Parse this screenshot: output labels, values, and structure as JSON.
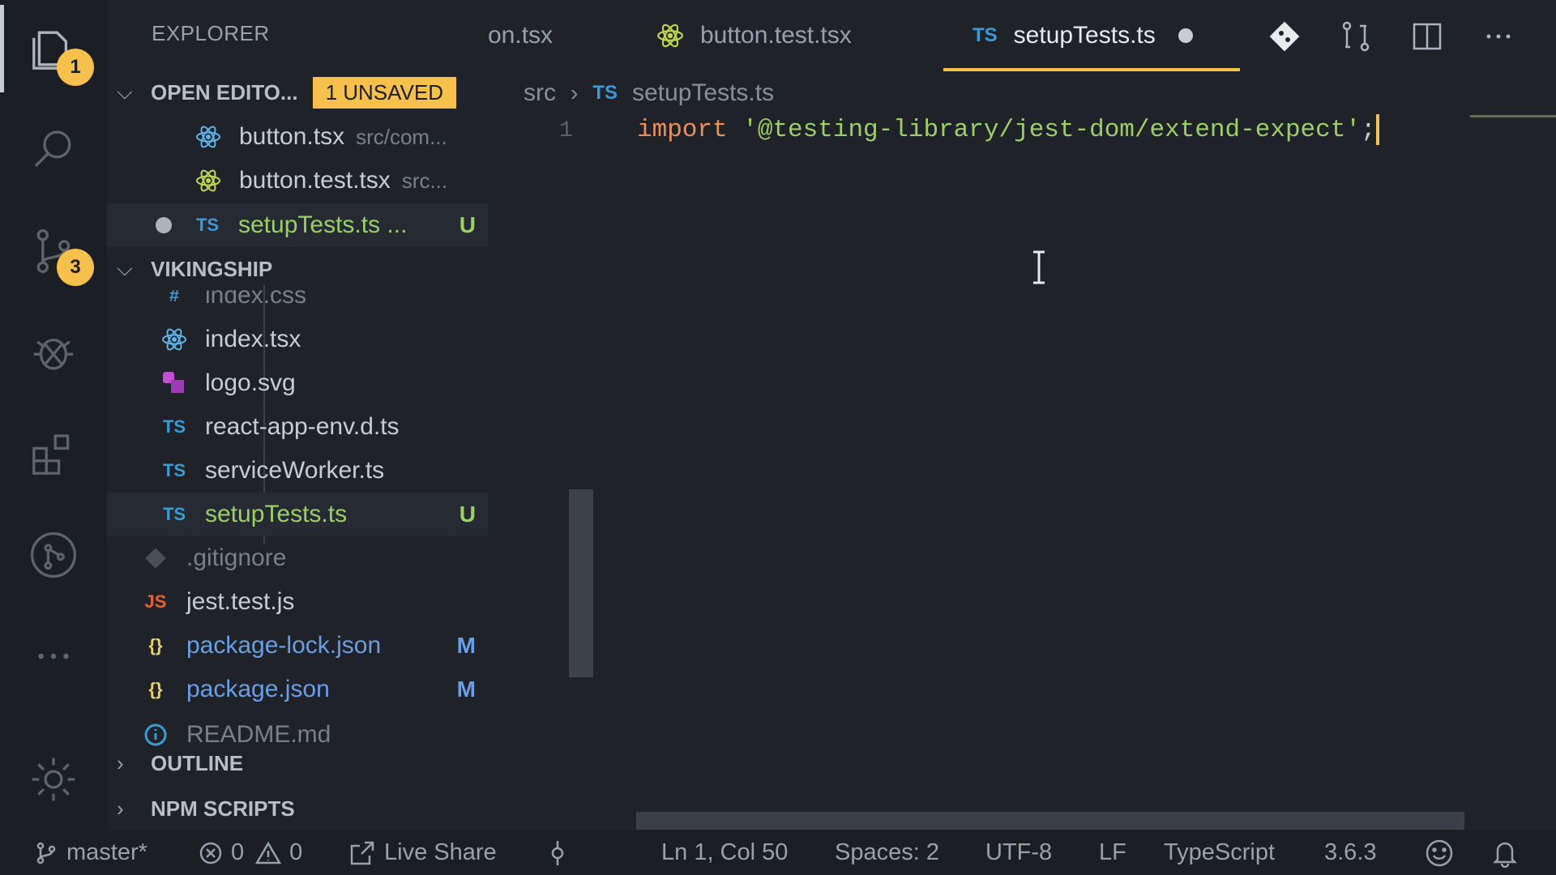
{
  "activity_bar": {
    "explorer_badge": "1",
    "scm_badge": "3"
  },
  "sidebar": {
    "title": "EXPLORER",
    "open_editors": {
      "header": "OPEN EDITO...",
      "badge": "1 UNSAVED",
      "items": [
        {
          "name": "button.tsx",
          "desc": "src/com...",
          "icon": "react-icon"
        },
        {
          "name": "button.test.tsx",
          "desc": "src...",
          "icon": "react-icon"
        },
        {
          "name": "setupTests.ts ...",
          "status": "U",
          "icon_text": "TS"
        }
      ]
    },
    "project": {
      "header": "VIKINGSHIP",
      "items": [
        {
          "name": "index.css",
          "icon_text": "#"
        },
        {
          "name": "index.tsx",
          "icon": "react-icon"
        },
        {
          "name": "logo.svg",
          "icon": "svg-icon"
        },
        {
          "name": "react-app-env.d.ts",
          "icon_text": "TS"
        },
        {
          "name": "serviceWorker.ts",
          "icon_text": "TS"
        },
        {
          "name": "setupTests.ts",
          "icon_text": "TS",
          "status": "U"
        },
        {
          "name": ".gitignore",
          "icon": "git-icon"
        },
        {
          "name": "jest.test.js",
          "icon_text": "JS"
        },
        {
          "name": "package-lock.json",
          "icon_text": "{}",
          "status": "M"
        },
        {
          "name": "package.json",
          "icon_text": "{}",
          "status": "M"
        },
        {
          "name": "README.md",
          "icon": "info-icon"
        }
      ]
    },
    "outline_header": "OUTLINE",
    "npm_header": "NPM SCRIPTS"
  },
  "tabs": [
    {
      "label": "on.tsx"
    },
    {
      "label": "button.test.tsx"
    },
    {
      "label": "setupTests.ts",
      "icon_text": "TS",
      "active": true,
      "dirty": true
    }
  ],
  "breadcrumb": {
    "folder": "src",
    "file_icon": "TS",
    "file": "setupTests.ts"
  },
  "editor": {
    "line_number": "1",
    "code": {
      "keyword": "import",
      "string": "'@testing-library/jest-dom/extend-expect'",
      "terminator": ";"
    }
  },
  "statusbar": {
    "branch": "master*",
    "errors": "0",
    "warnings": "0",
    "live_share": "Live Share",
    "position": "Ln 1, Col 50",
    "spaces": "Spaces: 2",
    "encoding": "UTF-8",
    "eol": "LF",
    "language": "TypeScript",
    "version": "3.6.3"
  },
  "colors": {
    "accent": "#f5c14a",
    "background": "#1f2229",
    "untracked": "#9bd066",
    "modified": "#6a9fe3"
  }
}
